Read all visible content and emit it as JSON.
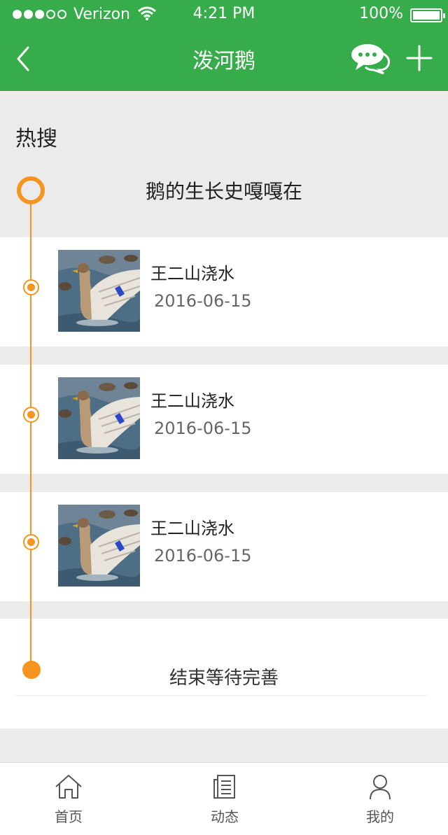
{
  "status_bar": {
    "carrier": "Verizon",
    "time": "4:21 PM",
    "battery": "100%"
  },
  "nav": {
    "title": "泼河鹅",
    "icons": [
      "back-chevron-icon",
      "chat-bubbles-icon",
      "plus-icon"
    ]
  },
  "section": {
    "title": "热搜"
  },
  "timeline": {
    "header": "鹅的生长史嘎嘎在",
    "items": [
      {
        "title": "王二山浇水",
        "date": "2016-06-15"
      },
      {
        "title": "王二山浇水",
        "date": "2016-06-15"
      },
      {
        "title": "王二山浇水",
        "date": "2016-06-15"
      }
    ],
    "end_text": "结束等待完善"
  },
  "tabbar": {
    "items": [
      {
        "label": "首页",
        "icon": "home-icon"
      },
      {
        "label": "动态",
        "icon": "news-icon"
      },
      {
        "label": "我的",
        "icon": "user-icon"
      }
    ]
  },
  "colors": {
    "primary": "#36ad4a",
    "accent": "#f7941e",
    "background": "#ebebeb"
  }
}
